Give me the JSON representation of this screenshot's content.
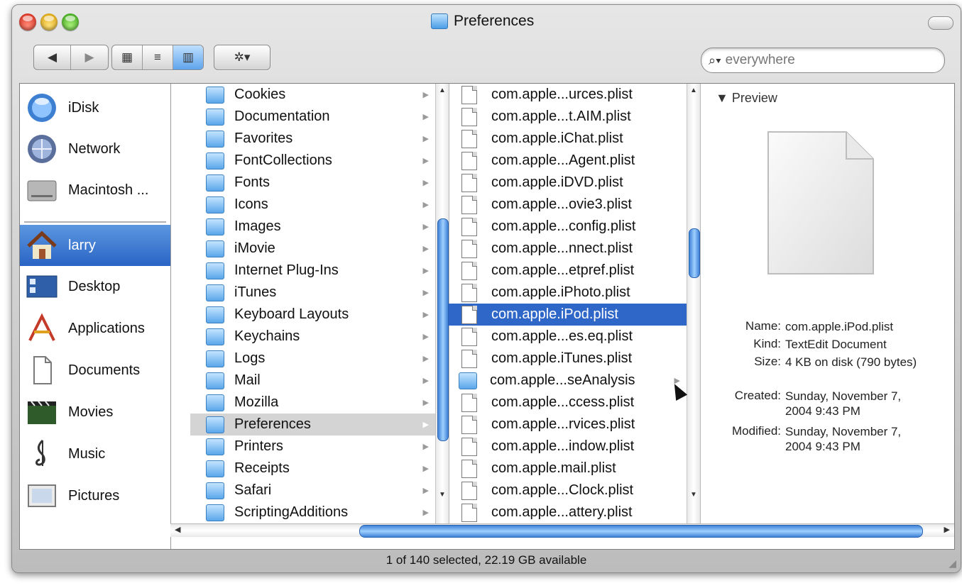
{
  "window": {
    "title": "Preferences"
  },
  "toolbar": {
    "back_glyph": "◀",
    "forward_glyph": "▶",
    "view_icon_glyph": "▦",
    "view_list_glyph": "≡",
    "view_column_glyph": "▥",
    "action_glyph": "✲▾",
    "search_placeholder": "everywhere"
  },
  "sidebar": {
    "items": [
      {
        "label": "iDisk",
        "icon": "idisk-icon"
      },
      {
        "label": "Network",
        "icon": "network-icon"
      },
      {
        "label": "Macintosh ...",
        "icon": "hard-drive-icon"
      },
      {
        "label": "larry",
        "icon": "home-icon",
        "selected": true
      },
      {
        "label": "Desktop",
        "icon": "desktop-icon"
      },
      {
        "label": "Applications",
        "icon": "applications-icon"
      },
      {
        "label": "Documents",
        "icon": "documents-icon"
      },
      {
        "label": "Movies",
        "icon": "movies-icon"
      },
      {
        "label": "Music",
        "icon": "music-icon"
      },
      {
        "label": "Pictures",
        "icon": "pictures-icon"
      }
    ]
  },
  "column1": {
    "items": [
      "Cookies",
      "Documentation",
      "Favorites",
      "FontCollections",
      "Fonts",
      "Icons",
      "Images",
      "iMovie",
      "Internet Plug-Ins",
      "iTunes",
      "Keyboard Layouts",
      "Keychains",
      "Logs",
      "Mail",
      "Mozilla",
      "Preferences",
      "Printers",
      "Receipts",
      "Safari",
      "ScriptingAdditions"
    ],
    "selected": "Preferences"
  },
  "column2": {
    "items": [
      {
        "label": "com.apple...urces.plist",
        "type": "file"
      },
      {
        "label": "com.apple...t.AIM.plist",
        "type": "file"
      },
      {
        "label": "com.apple.iChat.plist",
        "type": "file"
      },
      {
        "label": "com.apple...Agent.plist",
        "type": "file"
      },
      {
        "label": "com.apple.iDVD.plist",
        "type": "file"
      },
      {
        "label": "com.apple...ovie3.plist",
        "type": "file"
      },
      {
        "label": "com.apple...config.plist",
        "type": "file"
      },
      {
        "label": "com.apple...nnect.plist",
        "type": "file"
      },
      {
        "label": "com.apple...etpref.plist",
        "type": "file"
      },
      {
        "label": "com.apple.iPhoto.plist",
        "type": "file"
      },
      {
        "label": "com.apple.iPod.plist",
        "type": "file",
        "selected": true
      },
      {
        "label": "com.apple...es.eq.plist",
        "type": "file"
      },
      {
        "label": "com.apple.iTunes.plist",
        "type": "file"
      },
      {
        "label": "com.apple...seAnalysis",
        "type": "folder"
      },
      {
        "label": "com.apple...ccess.plist",
        "type": "file"
      },
      {
        "label": "com.apple...rvices.plist",
        "type": "file"
      },
      {
        "label": "com.apple...indow.plist",
        "type": "file"
      },
      {
        "label": "com.apple.mail.plist",
        "type": "file"
      },
      {
        "label": "com.apple...Clock.plist",
        "type": "file"
      },
      {
        "label": "com.apple...attery.plist",
        "type": "file"
      }
    ]
  },
  "preview": {
    "header": "Preview",
    "fields": [
      {
        "key": "Name:",
        "value": "com.apple.iPod.plist"
      },
      {
        "key": "Kind:",
        "value": "TextEdit Document"
      },
      {
        "key": "Size:",
        "value": "4 KB on disk (790 bytes)"
      },
      {
        "key": "Created:",
        "value": "Sunday, November 7, 2004 9:43 PM"
      },
      {
        "key": "Modified:",
        "value": "Sunday, November 7, 2004 9:43 PM"
      }
    ]
  },
  "status": {
    "text": "1 of 140 selected, 22.19 GB available"
  }
}
